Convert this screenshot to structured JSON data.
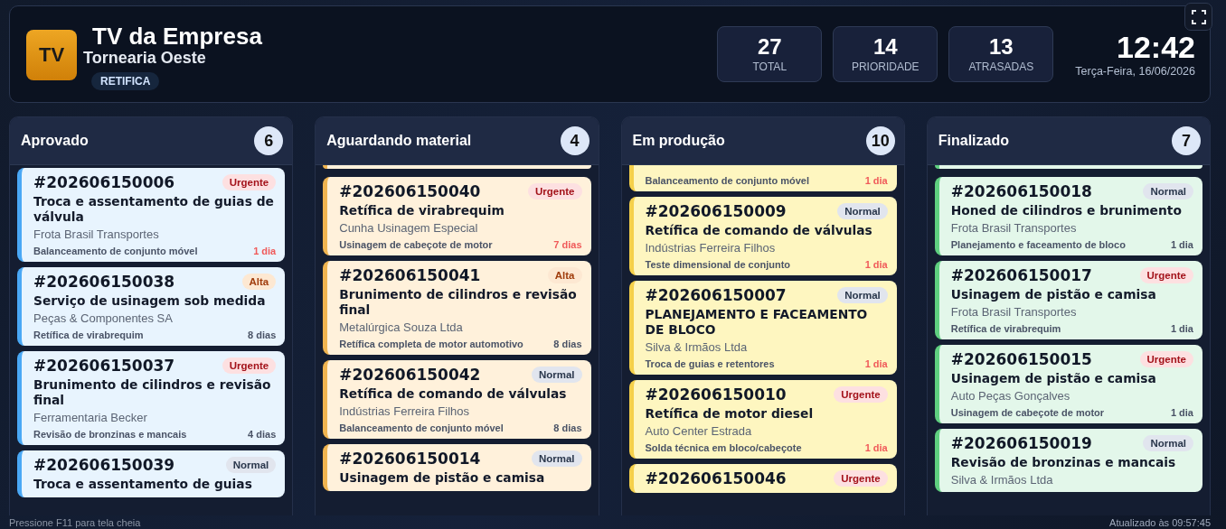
{
  "header": {
    "logo": "TV",
    "title": "TV da Empresa",
    "subtitle": "Tornearia Oeste",
    "tag": "RETIFICA",
    "stats": [
      {
        "value": "27",
        "label": "TOTAL"
      },
      {
        "value": "14",
        "label": "PRIORIDADE"
      },
      {
        "value": "13",
        "label": "ATRASADAS"
      }
    ],
    "clock": "12:42",
    "date": "Terça-Feira, 16/06/2026"
  },
  "columns": [
    {
      "title": "Aprovado",
      "count": "6",
      "color": "#4aa8f5",
      "cards": [
        {
          "id": "#202606150006",
          "priority": "Urgente",
          "kind": "urgente",
          "title": "Troca e assentamento de guias de válvula",
          "customer": "Frota Brasil Transportes",
          "service": "Balanceamento de conjunto móvel",
          "days": "1 dia",
          "late": true
        },
        {
          "id": "#202606150038",
          "priority": "Alta",
          "kind": "alta",
          "title": "Serviço de usinagem sob medida",
          "customer": "Peças & Componentes SA",
          "service": "Retífica de virabrequim",
          "days": "8 dias",
          "late": false
        },
        {
          "id": "#202606150037",
          "priority": "Urgente",
          "kind": "urgente",
          "title": "Brunimento de cilindros e revisão final",
          "customer": "Ferramentaria Becker",
          "service": "Revisão de bronzinas e mancais",
          "days": "4 dias",
          "late": false
        },
        {
          "id": "#202606150039",
          "priority": "Normal",
          "kind": "normal",
          "title": "Troca e assentamento de guias"
        }
      ]
    },
    {
      "title": "Aguardando material",
      "count": "4",
      "color": "#f0b450",
      "cards": [
        {
          "edge": true
        },
        {
          "id": "#202606150040",
          "priority": "Urgente",
          "kind": "urgente",
          "title": "Retífica de virabrequim",
          "customer": "Cunha Usinagem Especial",
          "service": "Usinagem de cabeçote de motor",
          "days": "7 dias",
          "late": true
        },
        {
          "id": "#202606150041",
          "priority": "Alta",
          "kind": "alta",
          "title": "Brunimento de cilindros e revisão final",
          "customer": "Metalúrgica Souza Ltda",
          "service": "Retífica completa de motor automotivo",
          "days": "8 dias",
          "late": false
        },
        {
          "id": "#202606150042",
          "priority": "Normal",
          "kind": "normal",
          "title": "Retífica de comando de válvulas",
          "customer": "Indústrias Ferreira Filhos",
          "service": "Balanceamento de conjunto móvel",
          "days": "8 dias",
          "late": false
        },
        {
          "id": "#202606150014",
          "priority": "Normal",
          "kind": "normal",
          "title": "Usinagem de pistão e camisa"
        }
      ]
    },
    {
      "title": "Em produção",
      "count": "10",
      "color": "#f5d04a",
      "cards": [
        {
          "service": "Balanceamento de conjunto móvel",
          "days": "1 dia",
          "late": true
        },
        {
          "id": "#202606150009",
          "priority": "Normal",
          "kind": "normal",
          "title": "Retífica de comando de válvulas",
          "customer": "Indústrias Ferreira Filhos",
          "service": "Teste dimensional de conjunto",
          "days": "1 dia",
          "late": true
        },
        {
          "id": "#202606150007",
          "priority": "Normal",
          "kind": "normal",
          "title": "PLANEJAMENTO E FACEAMENTO DE BLOCO",
          "customer": "Silva & Irmãos Ltda",
          "service": "Troca de guias e retentores",
          "days": "1 dia",
          "late": true
        },
        {
          "id": "#202606150010",
          "priority": "Urgente",
          "kind": "urgente",
          "title": "Retífica de motor diesel",
          "customer": "Auto Center Estrada",
          "service": "Solda técnica em bloco/cabeçote",
          "days": "1 dia",
          "late": true
        },
        {
          "id": "#202606150046",
          "priority": "Urgente",
          "kind": "urgente"
        }
      ]
    },
    {
      "title": "Finalizado",
      "count": "7",
      "color": "#5fcf80",
      "cards": [
        {
          "edge": true
        },
        {
          "id": "#202606150018",
          "priority": "Normal",
          "kind": "normal",
          "title": "Honed de cilindros e brunimento",
          "customer": "Frota Brasil Transportes",
          "service": "Planejamento e faceamento de bloco",
          "days": "1 dia",
          "late": false
        },
        {
          "id": "#202606150017",
          "priority": "Urgente",
          "kind": "urgente",
          "title": "Usinagem de pistão e camisa",
          "customer": "Frota Brasil Transportes",
          "service": "Retífica de virabrequim",
          "days": "1 dia",
          "late": false
        },
        {
          "id": "#202606150015",
          "priority": "Urgente",
          "kind": "urgente",
          "title": "Usinagem de pistão e camisa",
          "customer": "Auto Peças Gonçalves",
          "service": "Usinagem de cabeçote de motor",
          "days": "1 dia",
          "late": false
        },
        {
          "id": "#202606150019",
          "priority": "Normal",
          "kind": "normal",
          "title": "Revisão de bronzinas e mancais",
          "customer": "Silva & Irmãos Ltda"
        }
      ]
    }
  ],
  "hint": "Pressione F11 para tela cheia",
  "updated": "Atualizado às 09:57:45"
}
